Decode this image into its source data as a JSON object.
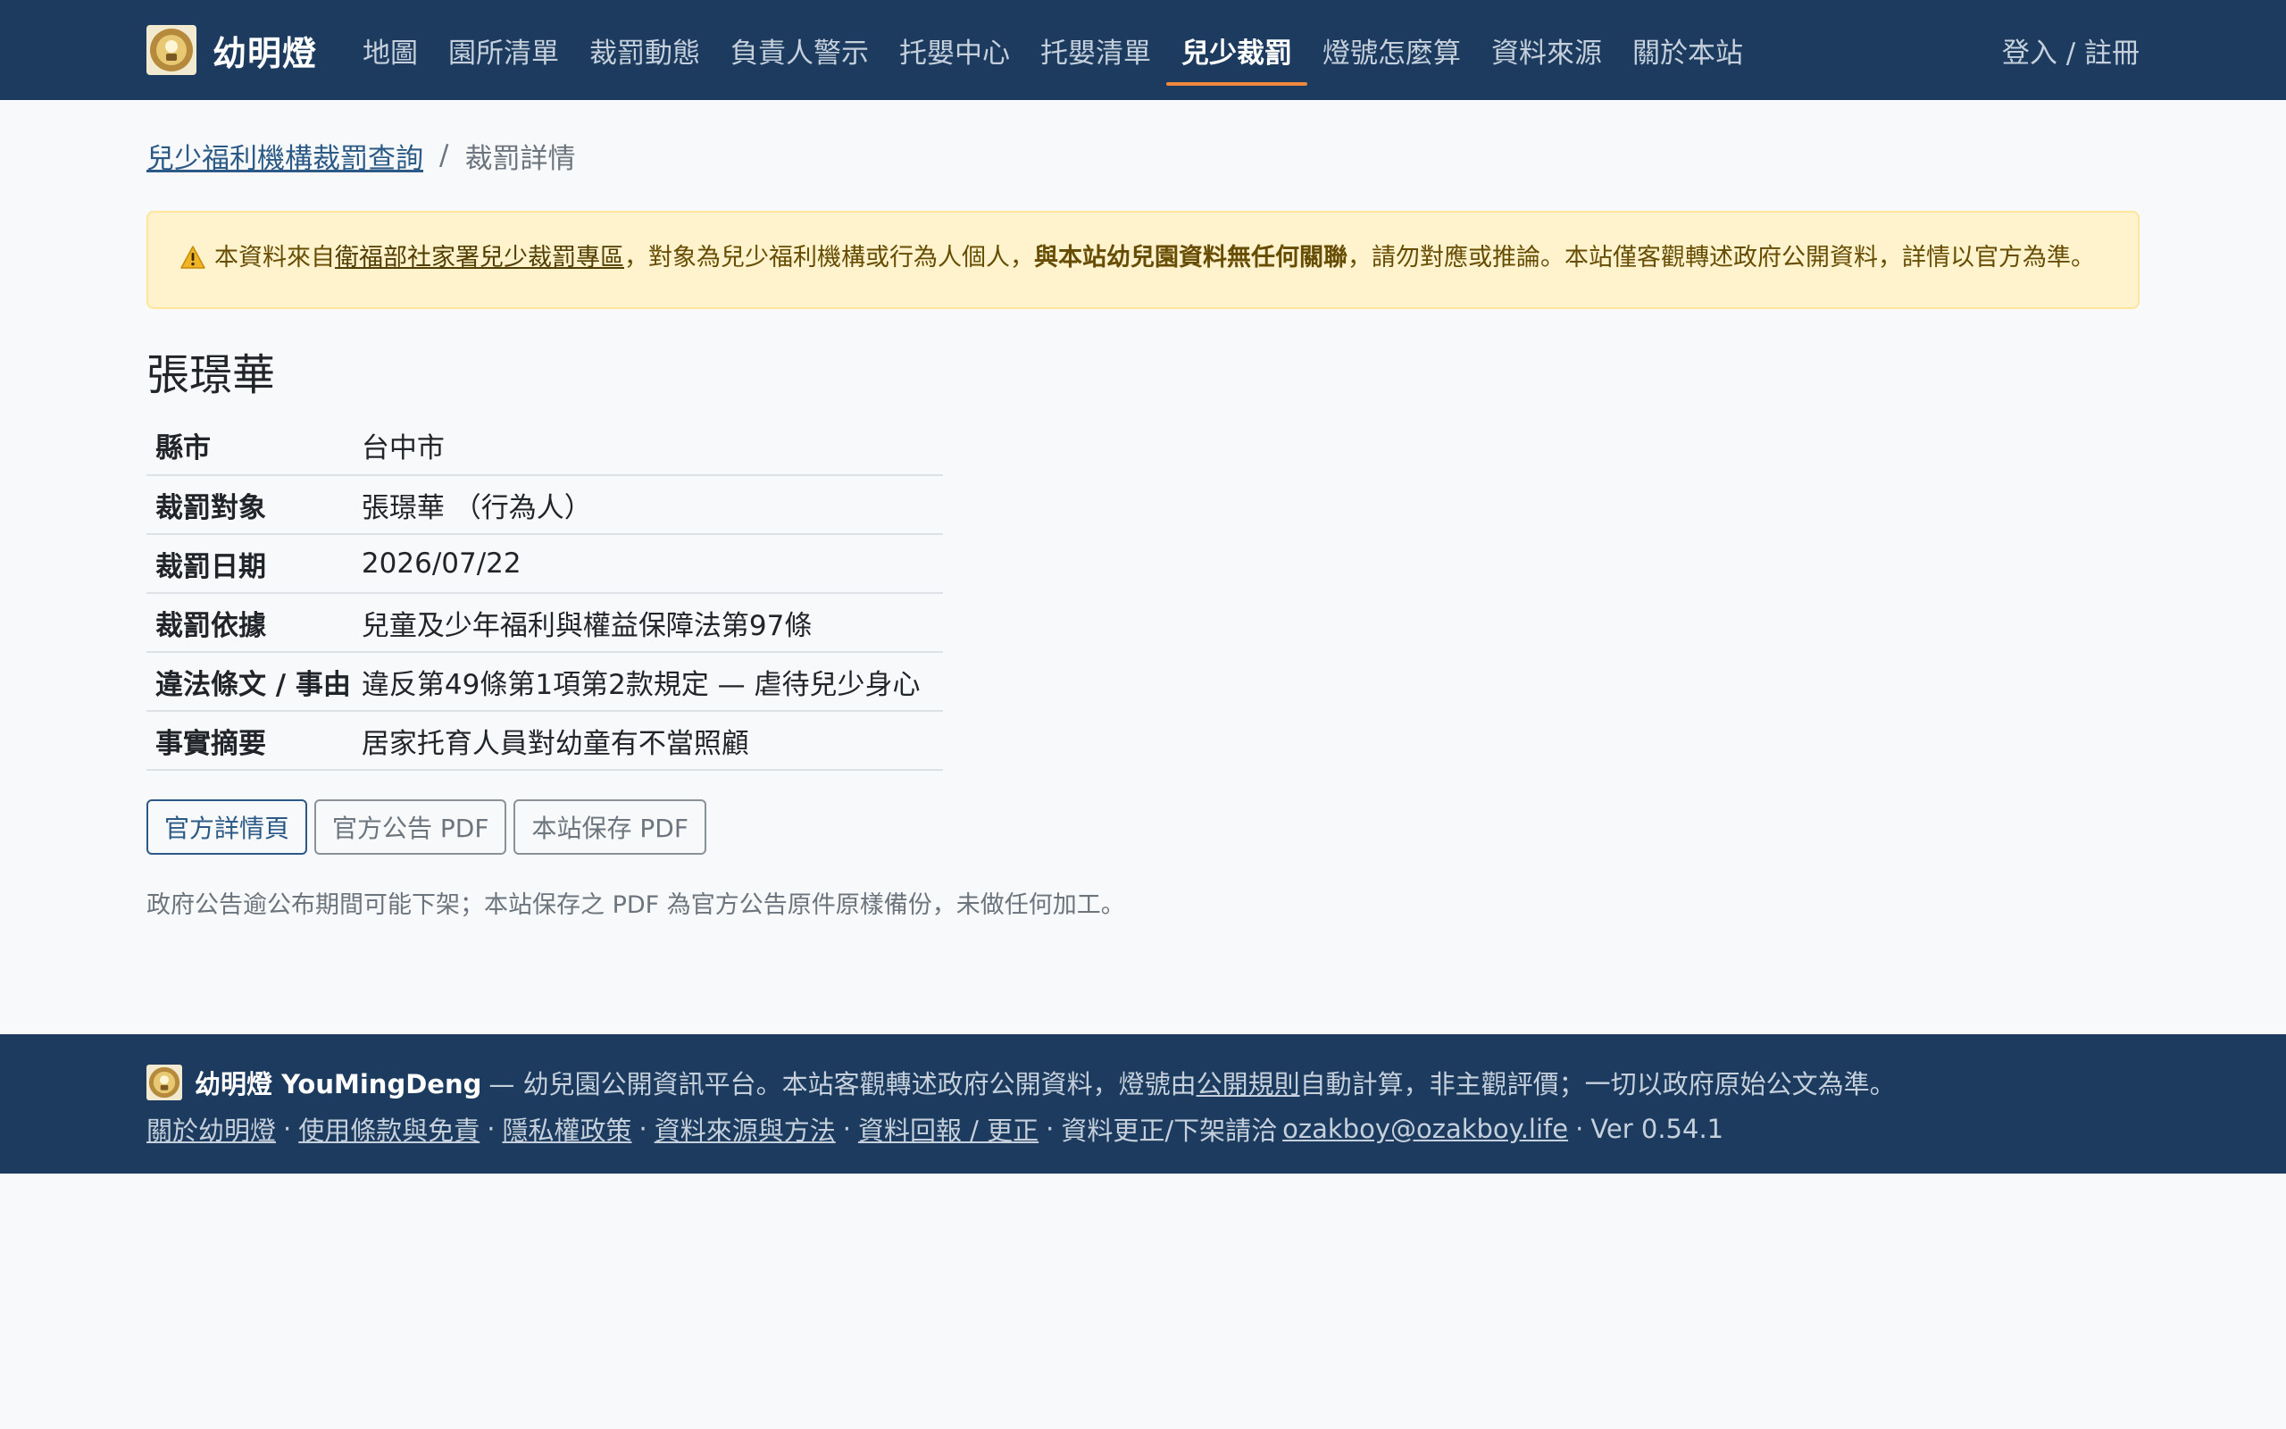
{
  "navbar": {
    "brand": "幼明燈",
    "items": [
      "地圖",
      "園所清單",
      "裁罰動態",
      "負責人警示",
      "托嬰中心",
      "托嬰清單",
      "兒少裁罰",
      "燈號怎麼算",
      "資料來源",
      "關於本站"
    ],
    "active_index": 6,
    "login": "登入 / 註冊"
  },
  "breadcrumb": {
    "parent": "兒少福利機構裁罰查詢",
    "separator": "/",
    "current": "裁罰詳情"
  },
  "alert": {
    "prefix": "本資料來自",
    "link": "衛福部社家署兒少裁罰專區",
    "middle": "，對象為兒少福利機構或行為人個人，",
    "bold": "與本站幼兒園資料無任何關聯",
    "suffix": "，請勿對應或推論。本站僅客觀轉述政府公開資料，詳情以官方為準。"
  },
  "record": {
    "name": "張璟華",
    "rows": [
      {
        "label": "縣市",
        "value": "台中市"
      },
      {
        "label": "裁罰對象",
        "value": "張璟華 （行為人）"
      },
      {
        "label": "裁罰日期",
        "value": "2026/07/22"
      },
      {
        "label": "裁罰依據",
        "value": "兒童及少年福利與權益保障法第97條"
      },
      {
        "label": "違法條文 / 事由",
        "value": "違反第49條第1項第2款規定 — 虐待兒少身心"
      },
      {
        "label": "事實摘要",
        "value": "居家托育人員對幼童有不當照顧"
      }
    ]
  },
  "buttons": {
    "official_detail": "官方詳情頁",
    "official_pdf": "官方公告 PDF",
    "saved_pdf": "本站保存 PDF"
  },
  "note": "政府公告逾公布期間可能下架；本站保存之 PDF 為官方公告原件原樣備份，未做任何加工。",
  "footer": {
    "brand": "幼明燈 YouMingDeng",
    "tagline_prefix": "— 幼兒園公開資訊平台。本站客觀轉述政府公開資料，燈號由",
    "tagline_link": "公開規則",
    "tagline_suffix": "自動計算，非主觀評價；一切以政府原始公文為準。",
    "links": [
      "關於幼明燈",
      "使用條款與免責",
      "隱私權政策",
      "資料來源與方法",
      "資料回報 / 更正"
    ],
    "contact_prefix": "資料更正/下架請洽",
    "email": "ozakboy@ozakboy.life",
    "version": "Ver 0.54.1",
    "separator": "·"
  },
  "colors": {
    "navbar_bg": "#1c3b5e",
    "active_underline": "#f0883e",
    "alert_bg": "#fff3cd",
    "link": "#2c5a86"
  },
  "icons": {
    "logo": "lamp-logo-icon",
    "alert": "warning-triangle-icon"
  }
}
